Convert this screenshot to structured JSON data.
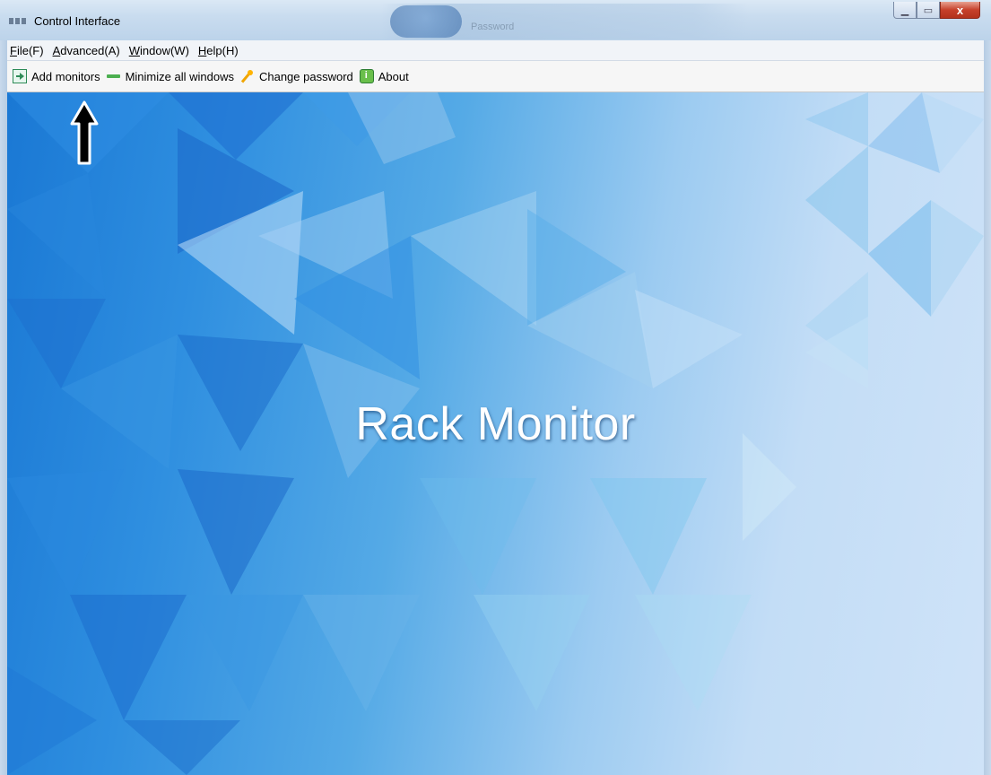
{
  "window": {
    "title": "Control Interface",
    "buttons": {
      "minimize_glyph": "▁",
      "maximize_glyph": "▭",
      "close_glyph": "x"
    },
    "bg_decoration_text": "Password"
  },
  "menu": {
    "items": [
      {
        "accelerator": "F",
        "rest": "ile(F)"
      },
      {
        "accelerator": "A",
        "rest": "dvanced(A)"
      },
      {
        "accelerator": "W",
        "rest": "indow(W)"
      },
      {
        "accelerator": "H",
        "rest": "elp(H)"
      }
    ]
  },
  "toolbar": {
    "add_monitors": "Add monitors",
    "minimize_all": "Minimize all windows",
    "change_password": "Change password",
    "about": "About",
    "icons": [
      "add-monitor-icon",
      "minimize-icon",
      "key-icon",
      "info-icon"
    ]
  },
  "main": {
    "hero_title": "Rack Monitor"
  },
  "colors": {
    "accent": "#1a78d4",
    "close": "#c6412b"
  }
}
